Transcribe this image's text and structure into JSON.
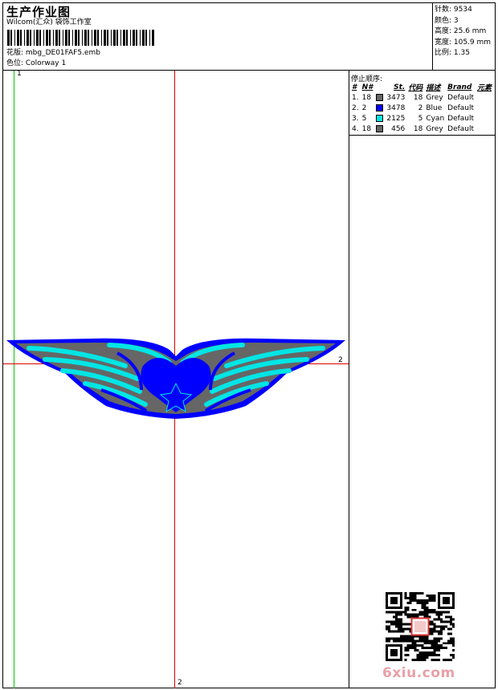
{
  "header": {
    "title": "生产作业图",
    "studio": "Wilcom(汇众) 袋饰工作室",
    "design_file": "花版: mbg_DE01FAF5.emb",
    "colorway": "色位: Colorway 1"
  },
  "stats": {
    "stitches": "针数: 9534",
    "colors": "颜色: 3",
    "height": "高度: 25.6 mm",
    "width": "宽度: 105.9 mm",
    "ratio": "比例: 1.35"
  },
  "stop_sequence": {
    "title": "停止顺序:",
    "headers": [
      "#",
      "N#",
      "St.",
      "代码",
      "描述",
      "Brand",
      "元素"
    ],
    "rows": [
      {
        "idx": "1.",
        "n": "18",
        "color": "#666666",
        "st": "3473",
        "code": "18",
        "desc": "Grey",
        "brand": "Default",
        "elem": ""
      },
      {
        "idx": "2.",
        "n": "2",
        "color": "#0000ff",
        "st": "3478",
        "code": "2",
        "desc": "Blue",
        "brand": "Default",
        "elem": ""
      },
      {
        "idx": "3.",
        "n": "5",
        "color": "#00e5e5",
        "st": "2125",
        "code": "5",
        "desc": "Cyan",
        "brand": "Default",
        "elem": ""
      },
      {
        "idx": "4.",
        "n": "18",
        "color": "#666666",
        "st": "456",
        "code": "18",
        "desc": "Grey",
        "brand": "Default",
        "elem": ""
      }
    ]
  },
  "guides": {
    "label_1_top": "1",
    "label_2_right": "2",
    "label_2_bottom": "2"
  },
  "colors": {
    "guide_red": "#e00000",
    "guide_green": "#00cc00",
    "blue": "#0000ff",
    "cyan": "#00e5e5",
    "grey": "#666666"
  },
  "watermark": "6xiu.com"
}
